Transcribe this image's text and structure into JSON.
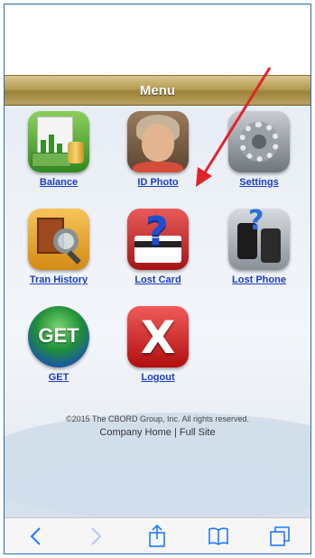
{
  "menu_bar": {
    "title": "Menu"
  },
  "tiles": [
    {
      "label": "Balance"
    },
    {
      "label": "ID Photo"
    },
    {
      "label": "Settings"
    },
    {
      "label": "Tran History"
    },
    {
      "label": "Lost Card"
    },
    {
      "label": "Lost Phone"
    },
    {
      "label": "GET",
      "icon_text": "GET"
    },
    {
      "label": "Logout",
      "icon_text": "X"
    }
  ],
  "footer": {
    "copyright": "©2015 The CBORD Group, Inc. All rights reserved.",
    "company_home": "Company Home",
    "separator": "|",
    "full_site": "Full Site"
  },
  "toolbar": {
    "buttons": [
      "back-icon",
      "forward-icon",
      "share-icon",
      "bookmarks-icon",
      "tabs-icon"
    ]
  },
  "colors": {
    "link": "#1a3dbf",
    "menu_bar": "#b59d52",
    "arrow": "#e0242a",
    "toolbar_icon": "#1f7aff"
  }
}
